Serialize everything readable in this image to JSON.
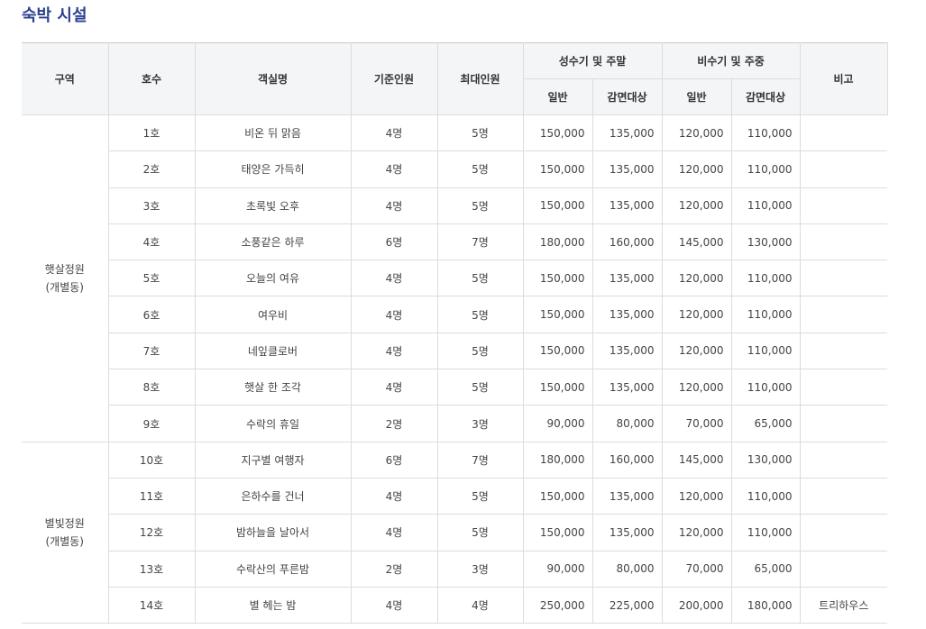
{
  "page_title": "숙박 시설",
  "table": {
    "headers": {
      "zone": "구역",
      "room_no": "호수",
      "room_name": "객실명",
      "base_capacity": "기준인원",
      "max_capacity": "최대인원",
      "peak_group": "성수기 및 주말",
      "offpeak_group": "비수기 및 주중",
      "general": "일반",
      "discount": "감면대상",
      "note": "비고"
    },
    "zones": [
      {
        "name": "햇살정원",
        "sub": "(개별동)",
        "rows": [
          {
            "no": "1호",
            "name": "비온 뒤 맑음",
            "base": "4명",
            "max": "5명",
            "peak_general": "150,000",
            "peak_discount": "135,000",
            "off_general": "120,000",
            "off_discount": "110,000",
            "note": ""
          },
          {
            "no": "2호",
            "name": "태양은 가득히",
            "base": "4명",
            "max": "5명",
            "peak_general": "150,000",
            "peak_discount": "135,000",
            "off_general": "120,000",
            "off_discount": "110,000",
            "note": ""
          },
          {
            "no": "3호",
            "name": "초록빛 오후",
            "base": "4명",
            "max": "5명",
            "peak_general": "150,000",
            "peak_discount": "135,000",
            "off_general": "120,000",
            "off_discount": "110,000",
            "note": ""
          },
          {
            "no": "4호",
            "name": "소풍같은 하루",
            "base": "6명",
            "max": "7명",
            "peak_general": "180,000",
            "peak_discount": "160,000",
            "off_general": "145,000",
            "off_discount": "130,000",
            "note": ""
          },
          {
            "no": "5호",
            "name": "오늘의 여유",
            "base": "4명",
            "max": "5명",
            "peak_general": "150,000",
            "peak_discount": "135,000",
            "off_general": "120,000",
            "off_discount": "110,000",
            "note": ""
          },
          {
            "no": "6호",
            "name": "여우비",
            "base": "4명",
            "max": "5명",
            "peak_general": "150,000",
            "peak_discount": "135,000",
            "off_general": "120,000",
            "off_discount": "110,000",
            "note": ""
          },
          {
            "no": "7호",
            "name": "네잎클로버",
            "base": "4명",
            "max": "5명",
            "peak_general": "150,000",
            "peak_discount": "135,000",
            "off_general": "120,000",
            "off_discount": "110,000",
            "note": ""
          },
          {
            "no": "8호",
            "name": "햇살 한 조각",
            "base": "4명",
            "max": "5명",
            "peak_general": "150,000",
            "peak_discount": "135,000",
            "off_general": "120,000",
            "off_discount": "110,000",
            "note": ""
          },
          {
            "no": "9호",
            "name": "수락의 휴일",
            "base": "2명",
            "max": "3명",
            "peak_general": "90,000",
            "peak_discount": "80,000",
            "off_general": "70,000",
            "off_discount": "65,000",
            "note": ""
          }
        ]
      },
      {
        "name": "별빛정원",
        "sub": "(개별동)",
        "rows": [
          {
            "no": "10호",
            "name": "지구별 여행자",
            "base": "6명",
            "max": "7명",
            "peak_general": "180,000",
            "peak_discount": "160,000",
            "off_general": "145,000",
            "off_discount": "130,000",
            "note": ""
          },
          {
            "no": "11호",
            "name": "은하수를 건너",
            "base": "4명",
            "max": "5명",
            "peak_general": "150,000",
            "peak_discount": "135,000",
            "off_general": "120,000",
            "off_discount": "110,000",
            "note": ""
          },
          {
            "no": "12호",
            "name": "밤하늘을 날아서",
            "base": "4명",
            "max": "5명",
            "peak_general": "150,000",
            "peak_discount": "135,000",
            "off_general": "120,000",
            "off_discount": "110,000",
            "note": ""
          },
          {
            "no": "13호",
            "name": "수락산의 푸른밤",
            "base": "2명",
            "max": "3명",
            "peak_general": "90,000",
            "peak_discount": "80,000",
            "off_general": "70,000",
            "off_discount": "65,000",
            "note": ""
          },
          {
            "no": "14호",
            "name": "별 헤는 밤",
            "base": "4명",
            "max": "4명",
            "peak_general": "250,000",
            "peak_discount": "225,000",
            "off_general": "200,000",
            "off_discount": "180,000",
            "note": "트리하우스"
          }
        ]
      }
    ]
  }
}
